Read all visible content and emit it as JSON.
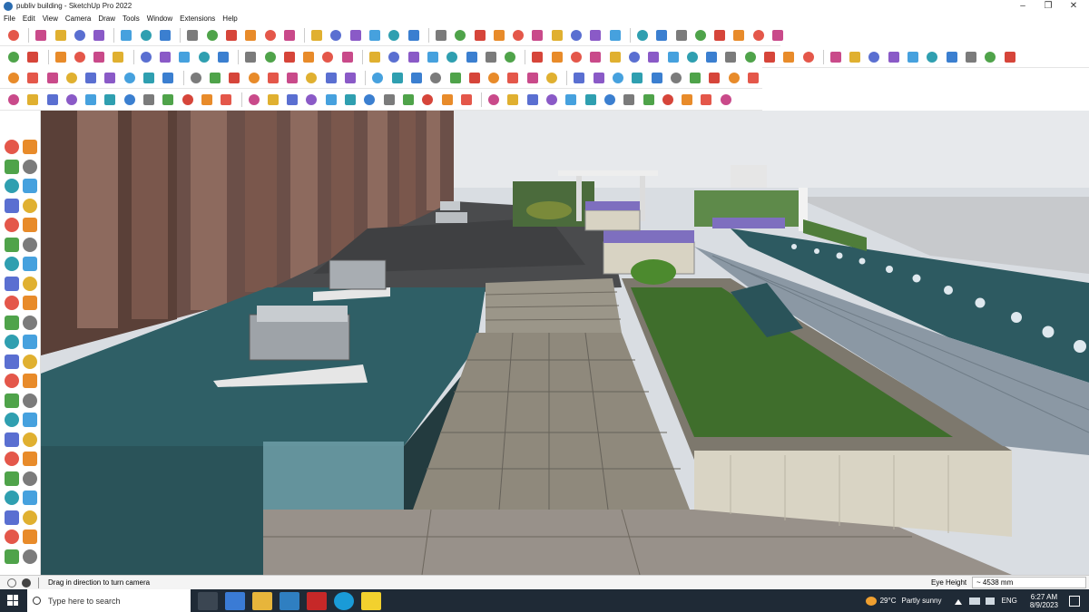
{
  "window": {
    "title": "publiv building - SketchUp Pro 2022",
    "controls": [
      "–",
      "❐",
      "✕"
    ]
  },
  "menu": [
    "File",
    "Edit",
    "View",
    "Camera",
    "Draw",
    "Tools",
    "Window",
    "Extensions",
    "Help"
  ],
  "status": {
    "message": "Drag in direction to turn camera",
    "measurement_label": "Eye Height",
    "measurement_value": "~ 4538 mm"
  },
  "taskbar": {
    "search_placeholder": "Type here to search",
    "weather_temp": "29°C",
    "weather_desc": "Partly sunny",
    "language": "ENG",
    "time": "6:27 AM",
    "date": "8/9/2023"
  },
  "colors": {
    "accent": "#2b6cb0",
    "water": "#2f5f66",
    "grass": "#3f6e2c",
    "paving": "#8a8376",
    "taskbar": "#1f2a36"
  },
  "icons": {
    "toolbar": [
      "zoom-window-icon",
      "select-icon",
      "eraser-icon",
      "line-icon",
      "arc-icon",
      "rectangle-icon",
      "push-pull-icon",
      "move-icon",
      "rotate-icon",
      "scale-icon",
      "offset-icon",
      "tape-measure-icon",
      "dimension-icon",
      "text-icon",
      "orbit-icon",
      "pan-icon",
      "zoom-icon",
      "zoom-extents-icon"
    ],
    "left": [
      "select-icon",
      "orbit-icon",
      "paint-bucket-icon",
      "eraser-icon",
      "line-icon",
      "freehand-icon"
    ]
  }
}
